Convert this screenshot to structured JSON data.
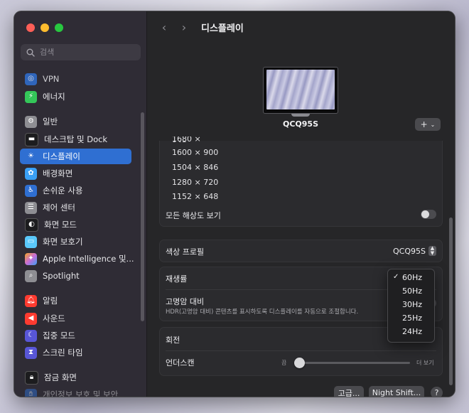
{
  "window": {
    "title": "디스플레이",
    "back_icon": "chevron-left-icon",
    "forward_icon": "chevron-right-icon"
  },
  "sidebar": {
    "search_placeholder": "검색",
    "items": [
      {
        "label": "VPN",
        "icon": "vpn-icon",
        "color": "#2f6fd2"
      },
      {
        "label": "에너지",
        "icon": "battery-icon",
        "color": "#34c759"
      },
      {
        "label": "일반",
        "icon": "gear-icon",
        "color": "#8e8e93"
      },
      {
        "label": "데스크탑 및 Dock",
        "icon": "dock-icon",
        "color": "#1c1c1e"
      },
      {
        "label": "디스플레이",
        "icon": "sun-icon",
        "color": "#2f6fd2",
        "selected": true
      },
      {
        "label": "배경화면",
        "icon": "flower-icon",
        "color": "#3aa0f5"
      },
      {
        "label": "손쉬운 사용",
        "icon": "accessibility-icon",
        "color": "#2f6fd2"
      },
      {
        "label": "제어 센터",
        "icon": "sliders-icon",
        "color": "#8e8e93"
      },
      {
        "label": "화면 모드",
        "icon": "appearance-icon",
        "color": "#1c1c1e"
      },
      {
        "label": "화면 보호기",
        "icon": "screensaver-icon",
        "color": "#5ac8fa"
      },
      {
        "label": "Apple Intelligence 및...",
        "icon": "apple-intelligence-icon",
        "color": "#c86dd7"
      },
      {
        "label": "Spotlight",
        "icon": "spotlight-icon",
        "color": "#8e8e93"
      },
      {
        "label": "알림",
        "icon": "bell-icon",
        "color": "#ff3b30"
      },
      {
        "label": "사운드",
        "icon": "speaker-icon",
        "color": "#ff3b30"
      },
      {
        "label": "집중 모드",
        "icon": "moon-icon",
        "color": "#5856d6"
      },
      {
        "label": "스크린 타임",
        "icon": "hourglass-icon",
        "color": "#5856d6"
      },
      {
        "label": "잠금 화면",
        "icon": "lock-icon",
        "color": "#1c1c1e"
      },
      {
        "label": "개인정보 보호 및 보안",
        "icon": "hand-icon",
        "color": "#2f6fd2"
      }
    ]
  },
  "display": {
    "monitor_name": "QCQ95S",
    "add_icon": "plus-icon",
    "add_chevron": "chevron-down-icon",
    "resolutions": [
      "1600 × 900",
      "1504 × 846",
      "1280 × 720",
      "1152 × 648"
    ],
    "show_all_resolutions_label": "모든 해상도 보기",
    "show_all_resolutions": false,
    "color_profile_label": "색상 프로필",
    "color_profile_value": "QCQ95S",
    "refresh_rate_label": "재생률",
    "hdr_label": "고명암 대비",
    "hdr_description": "HDR(고명암 대비) 콘텐츠를 표시하도록 디스플레이를 자동으로 조절합니다.",
    "hdr_enabled": false,
    "rotation_label": "회전",
    "underscan_label": "언더스캔",
    "underscan_min_label": "끔",
    "underscan_max_label": "더 보기",
    "underscan_value": 0,
    "advanced_button": "고급...",
    "night_shift_button": "Night Shift...",
    "help_button": "?"
  },
  "refresh_dropdown": {
    "options": [
      "60Hz",
      "50Hz",
      "30Hz",
      "25Hz",
      "24Hz"
    ],
    "selected": "60Hz",
    "check": "✓"
  }
}
